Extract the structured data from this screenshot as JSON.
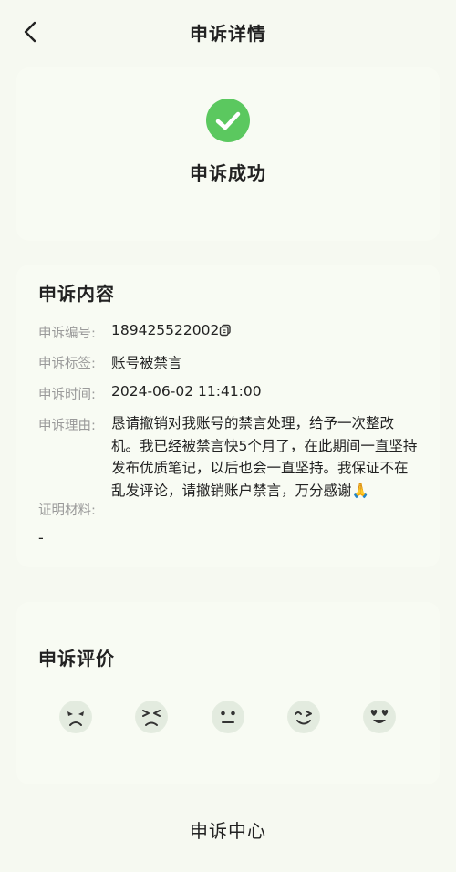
{
  "header": {
    "title": "申诉详情",
    "back_icon": "chevron-left-icon"
  },
  "status": {
    "icon": "check-circle-icon",
    "icon_color": "#5bc85f",
    "text": "申诉成功"
  },
  "content": {
    "section_title": "申诉内容",
    "id_label": "申诉编号:",
    "id_value": "189425522002",
    "tag_label": "申诉标签:",
    "tag_value": "账号被禁言",
    "time_label": "申诉时间:",
    "time_value": "2024-06-02 11:41:00",
    "reason_label": "申诉理由:",
    "reason_value": "恳请撤销对我账号的禁言处理，给予一次整改机。我已经被禁言快5个月了，在此期间一直坚持发布优质笔记，以后也会一直坚持。我保证不在乱发评论，请撤销账户禁言，万分感谢🙏",
    "proof_label": "证明材料:",
    "proof_value": "-"
  },
  "rating": {
    "section_title": "申诉评价",
    "faces": [
      "very-dissatisfied-face-icon",
      "dissatisfied-face-icon",
      "neutral-face-icon",
      "satisfied-face-icon",
      "very-satisfied-face-icon"
    ]
  },
  "footer": {
    "label": "申诉中心"
  }
}
